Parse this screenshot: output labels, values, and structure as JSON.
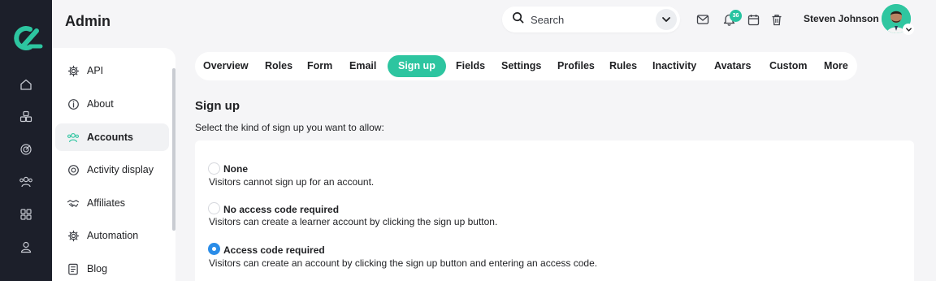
{
  "app": {
    "section_title": "Admin"
  },
  "rail": {
    "items": [
      {
        "icon": "home-icon"
      },
      {
        "icon": "courses-icon"
      },
      {
        "icon": "target-icon"
      },
      {
        "icon": "users-icon"
      },
      {
        "icon": "apps-icon"
      },
      {
        "icon": "profile-icon"
      }
    ]
  },
  "search": {
    "placeholder": "Search"
  },
  "header": {
    "notification_count": "36",
    "user_name": "Steven Johnson"
  },
  "sidebar": {
    "items": [
      {
        "label": "API",
        "icon": "gear-icon"
      },
      {
        "label": "About",
        "icon": "info-icon"
      },
      {
        "label": "Accounts",
        "icon": "users-icon",
        "active": true
      },
      {
        "label": "Activity display",
        "icon": "target-icon"
      },
      {
        "label": "Affiliates",
        "icon": "handshake-icon"
      },
      {
        "label": "Automation",
        "icon": "gear-icon"
      },
      {
        "label": "Blog",
        "icon": "document-icon"
      }
    ]
  },
  "tabs": [
    {
      "label": "Overview"
    },
    {
      "label": "Roles"
    },
    {
      "label": "Form"
    },
    {
      "label": "Email"
    },
    {
      "label": "Sign up",
      "active": true
    },
    {
      "label": "Fields"
    },
    {
      "label": "Settings"
    },
    {
      "label": "Profiles"
    },
    {
      "label": "Rules"
    },
    {
      "label": "Inactivity"
    },
    {
      "label": "Avatars"
    },
    {
      "label": "Custom"
    },
    {
      "label": "More"
    }
  ],
  "content": {
    "title": "Sign up",
    "description": "Select the kind of sign up you want to allow:",
    "options": [
      {
        "label": "None",
        "description": "Visitors cannot sign up for an account.",
        "selected": false
      },
      {
        "label": "No access code required",
        "description": "Visitors can create a learner account by clicking the sign up button.",
        "selected": false
      },
      {
        "label": "Access code required",
        "description": "Visitors can create an account by clicking the sign up button and entering an access code.",
        "selected": true
      }
    ]
  },
  "colors": {
    "accent": "#2dc5a0",
    "rail_bg": "#1c1f2a",
    "radio_selected": "#2b8de8"
  }
}
